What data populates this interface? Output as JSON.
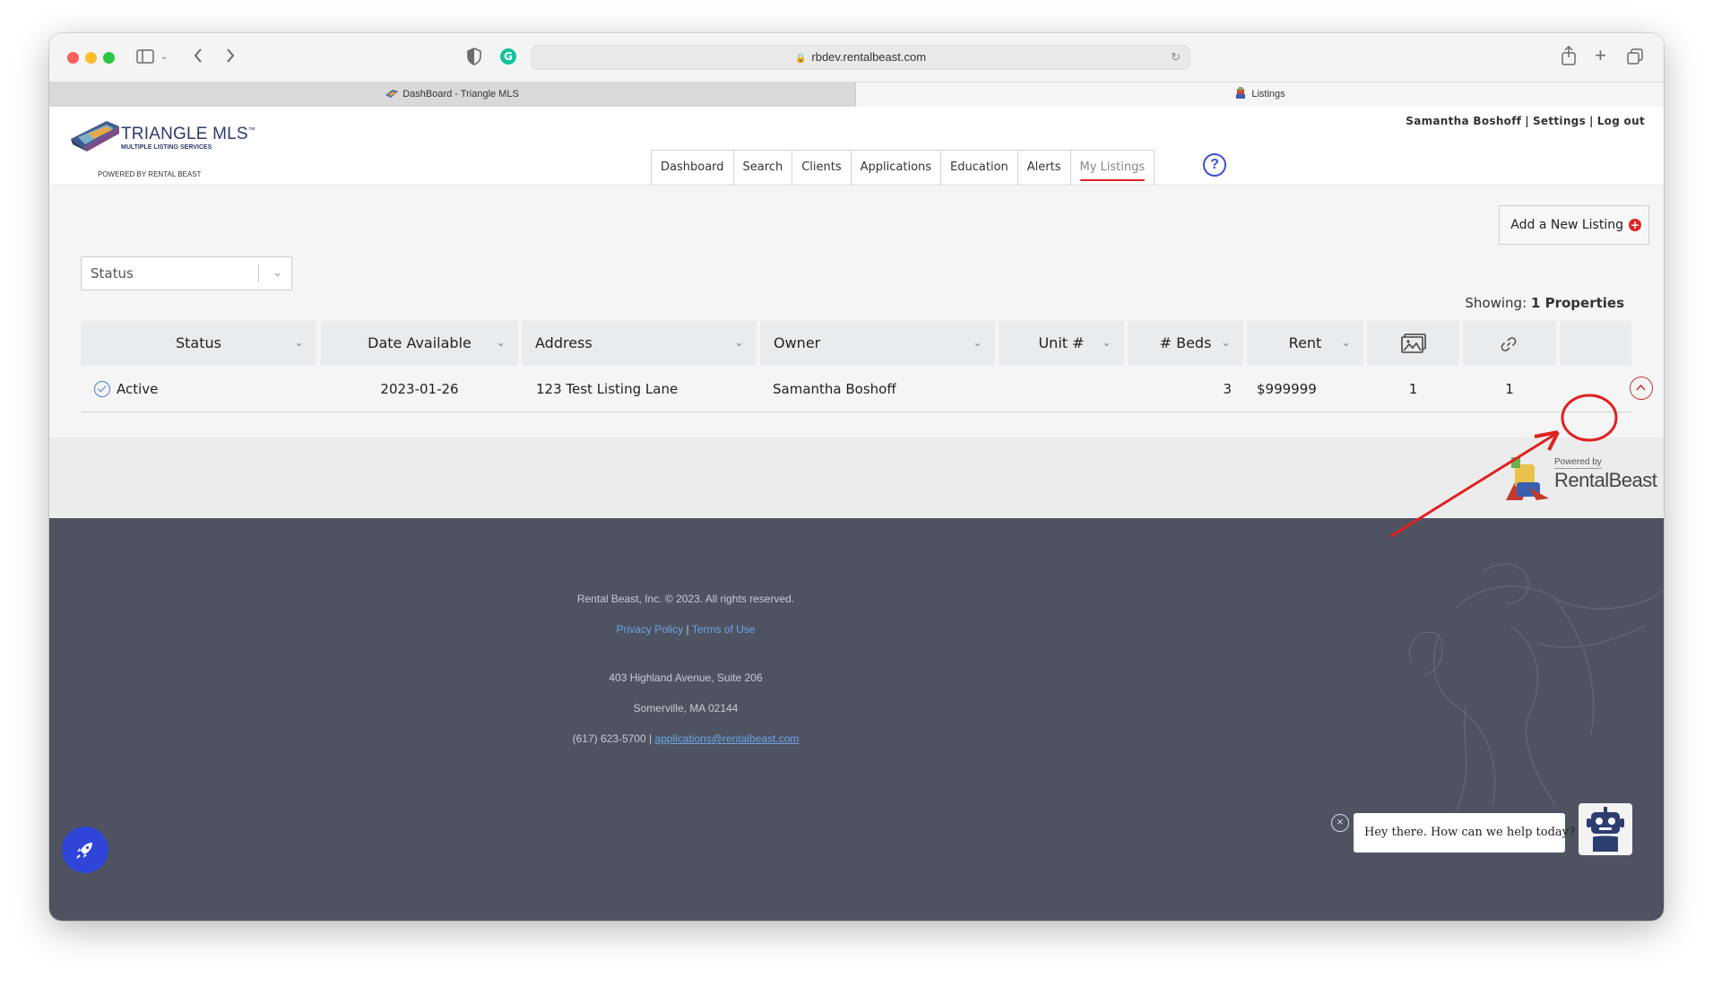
{
  "browser": {
    "url": "rbdev.rentalbeast.com",
    "tabs": [
      {
        "label": "DashBoard - Triangle MLS",
        "active": false
      },
      {
        "label": "Listings",
        "active": true
      }
    ]
  },
  "header": {
    "logo_title": "TRIANGLE MLS",
    "logo_trademark": "™",
    "logo_subtitle": "MULTIPLE LISTING SERVICES",
    "logo_powered": "POWERED BY RENTAL BEAST",
    "user_name": "Samantha Boshoff",
    "settings_label": "Settings",
    "logout_label": "Log out",
    "separator": "|",
    "nav": [
      {
        "label": "Dashboard"
      },
      {
        "label": "Search"
      },
      {
        "label": "Clients"
      },
      {
        "label": "Applications"
      },
      {
        "label": "Education"
      },
      {
        "label": "Alerts"
      },
      {
        "label": "My Listings",
        "active": true
      }
    ],
    "help_icon": "?"
  },
  "main": {
    "add_listing_label": "Add a New Listing",
    "status_filter_placeholder": "Status",
    "showing_label": "Showing:",
    "showing_value": "1 Properties",
    "table": {
      "columns": [
        "Status",
        "Date Available",
        "Address",
        "Owner",
        "Unit #",
        "# Beds",
        "Rent",
        "photos-icon",
        "link-icon",
        ""
      ],
      "rows": [
        {
          "status": "Active",
          "date_available": "2023-01-26",
          "address": "123 Test Listing Lane",
          "owner": "Samantha Boshoff",
          "unit": "",
          "beds": "3",
          "rent": "$999999",
          "photos": "1",
          "links": "1"
        }
      ]
    }
  },
  "powered_band": {
    "powered_by": "Powered by",
    "brand": "RentalBeast"
  },
  "footer": {
    "copyright": "Rental Beast, Inc. © 2023. All rights reserved.",
    "privacy": "Privacy Policy",
    "terms": "Terms of Use",
    "separator": "|",
    "address_line1": "403 Highland Avenue, Suite 206",
    "address_line2": "Somerville, MA 02144",
    "phone": "(617) 623-5700 |",
    "email": "applications@rentalbeast.com"
  },
  "chat": {
    "message": "Hey there. How can we help today?"
  },
  "colors": {
    "accent_blue": "#3a50d8",
    "annotation_red": "#e02020",
    "footer_bg": "#4f5361",
    "link_blue": "#6aa4e8"
  }
}
